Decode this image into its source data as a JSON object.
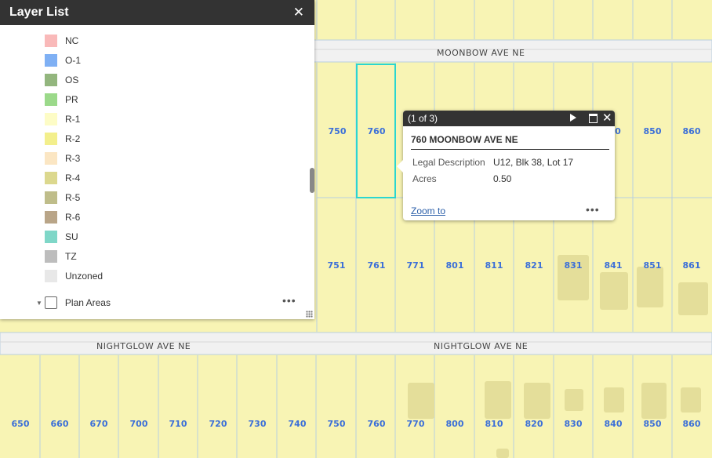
{
  "map": {
    "colors": {
      "parcel_fill": "#f8f4b4",
      "parcel_line": "#b9cfe0",
      "road_fill": "#f1f1f1",
      "building": "#e4de9a",
      "selection": "#2bd6d0",
      "lot_label": "#3b6fd8"
    },
    "streets": {
      "moonbow": "MOONBOW AVE NE",
      "nightglow_left": "NIGHTGLOW AVE NE",
      "nightglow_right": "NIGHTGLOW AVE NE"
    },
    "lots_row1": [
      "750",
      "760",
      "850",
      "860"
    ],
    "lots_row1_partial": "0",
    "lots_row2": [
      "751",
      "761",
      "771",
      "801",
      "811",
      "821",
      "831",
      "841",
      "851",
      "861"
    ],
    "lots_row3": [
      "650",
      "660",
      "670",
      "700",
      "710",
      "720",
      "730",
      "740",
      "750",
      "760",
      "770",
      "800",
      "810",
      "820",
      "830",
      "840",
      "850",
      "860"
    ]
  },
  "layer_list": {
    "title": "Layer List",
    "close_icon": "close-icon",
    "legend": [
      {
        "label": "NC",
        "color": "#f9b9b9"
      },
      {
        "label": "O-1",
        "color": "#7fb0f4"
      },
      {
        "label": "OS",
        "color": "#93b67e"
      },
      {
        "label": "PR",
        "color": "#9bd98a"
      },
      {
        "label": "R-1",
        "color": "#fdfcc6"
      },
      {
        "label": "R-2",
        "color": "#f3ef8c"
      },
      {
        "label": "R-3",
        "color": "#fbe6c3"
      },
      {
        "label": "R-4",
        "color": "#dcd88e"
      },
      {
        "label": "R-5",
        "color": "#bfbd8a"
      },
      {
        "label": "R-6",
        "color": "#b9a588"
      },
      {
        "label": "SU",
        "color": "#7fd7c8"
      },
      {
        "label": "TZ",
        "color": "#bdbdbd"
      },
      {
        "label": "Unzoned",
        "color": "#e8e8e8"
      }
    ],
    "plan_areas_label": "Plan Areas",
    "more_icon": "more-options-icon"
  },
  "popup": {
    "count": "(1 of 3)",
    "title": "760 MOONBOW AVE NE",
    "fields": [
      {
        "name": "Legal Description",
        "value": "U12, Blk 38, Lot 17"
      },
      {
        "name": "Acres",
        "value": "0.50"
      }
    ],
    "zoom_label": "Zoom to"
  }
}
